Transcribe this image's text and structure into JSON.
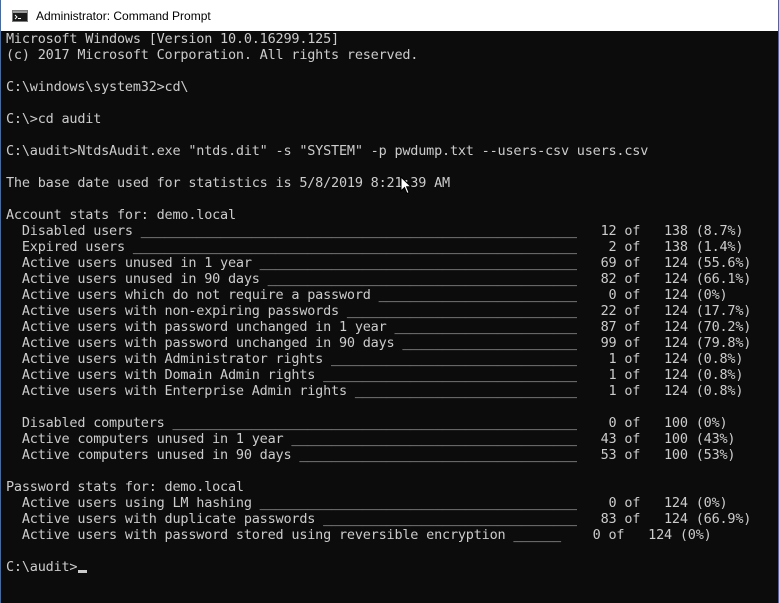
{
  "window": {
    "title": "Administrator: Command Prompt",
    "icon": "cmd-icon"
  },
  "console": {
    "lines": [
      "Microsoft Windows [Version 10.0.16299.125]",
      "(c) 2017 Microsoft Corporation. All rights reserved.",
      "",
      "C:\\windows\\system32>cd\\",
      "",
      "C:\\>cd audit",
      "",
      "C:\\audit>NtdsAudit.exe \"ntds.dit\" -s \"SYSTEM\" -p pwdump.txt --users-csv users.csv",
      "",
      "The base date used for statistics is 5/8/2019 8:21:39 AM",
      "",
      "Account stats for: demo.local",
      "  Disabled users _______________________________________________________   12 of   138 (8.7%)",
      "  Expired users ________________________________________________________    2 of   138 (1.4%)",
      "  Active users unused in 1 year ________________________________________   69 of   124 (55.6%)",
      "  Active users unused in 90 days _______________________________________   82 of   124 (66.1%)",
      "  Active users which do not require a password _________________________    0 of   124 (0%)",
      "  Active users with non-expiring passwords _____________________________   22 of   124 (17.7%)",
      "  Active users with password unchanged in 1 year _______________________   87 of   124 (70.2%)",
      "  Active users with password unchanged in 90 days ______________________   99 of   124 (79.8%)",
      "  Active users with Administrator rights _______________________________    1 of   124 (0.8%)",
      "  Active users with Domain Admin rights ________________________________    1 of   124 (0.8%)",
      "  Active users with Enterprise Admin rights ____________________________    1 of   124 (0.8%)",
      "",
      "  Disabled computers ___________________________________________________    0 of   100 (0%)",
      "  Active computers unused in 1 year ____________________________________   43 of   100 (43%)",
      "  Active computers unused in 90 days ___________________________________   53 of   100 (53%)",
      "",
      "Password stats for: demo.local",
      "  Active users using LM hashing ________________________________________    0 of   124 (0%)",
      "  Active users with duplicate passwords ________________________________   83 of   124 (66.9%)",
      "  Active users with password stored using reversible encryption ______    0 of   124 (0%)",
      "",
      ""
    ],
    "prompt": "C:\\audit>"
  },
  "colors": {
    "background": "#0c0c0c",
    "text": "#cccccc",
    "titlebar": "#ffffff",
    "border": "#2a6fd6"
  }
}
